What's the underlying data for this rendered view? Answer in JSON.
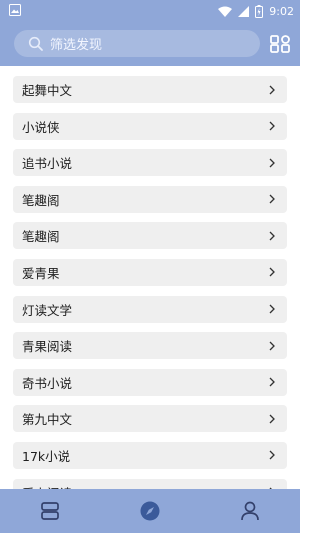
{
  "status": {
    "time": "9:02",
    "icons": [
      "image-icon",
      "wifi-icon",
      "signal-icon",
      "battery-icon"
    ]
  },
  "search": {
    "placeholder": "筛选发现"
  },
  "sources": [
    {
      "label": "起舞中文"
    },
    {
      "label": "小说侠"
    },
    {
      "label": "追书小说"
    },
    {
      "label": "笔趣阁"
    },
    {
      "label": "笔趣阁"
    },
    {
      "label": "爱青果"
    },
    {
      "label": "灯读文学"
    },
    {
      "label": "青果阅读"
    },
    {
      "label": "奇书小说"
    },
    {
      "label": "第九中文"
    },
    {
      "label": "17k小说"
    },
    {
      "label": "爱上阅读"
    }
  ],
  "bottom_nav": [
    "bookshelf-icon",
    "discover-icon",
    "profile-icon"
  ],
  "colors": {
    "accent": "#8fa7d8",
    "item_bg": "#efefef",
    "active_nav": "#3b5a9a"
  }
}
